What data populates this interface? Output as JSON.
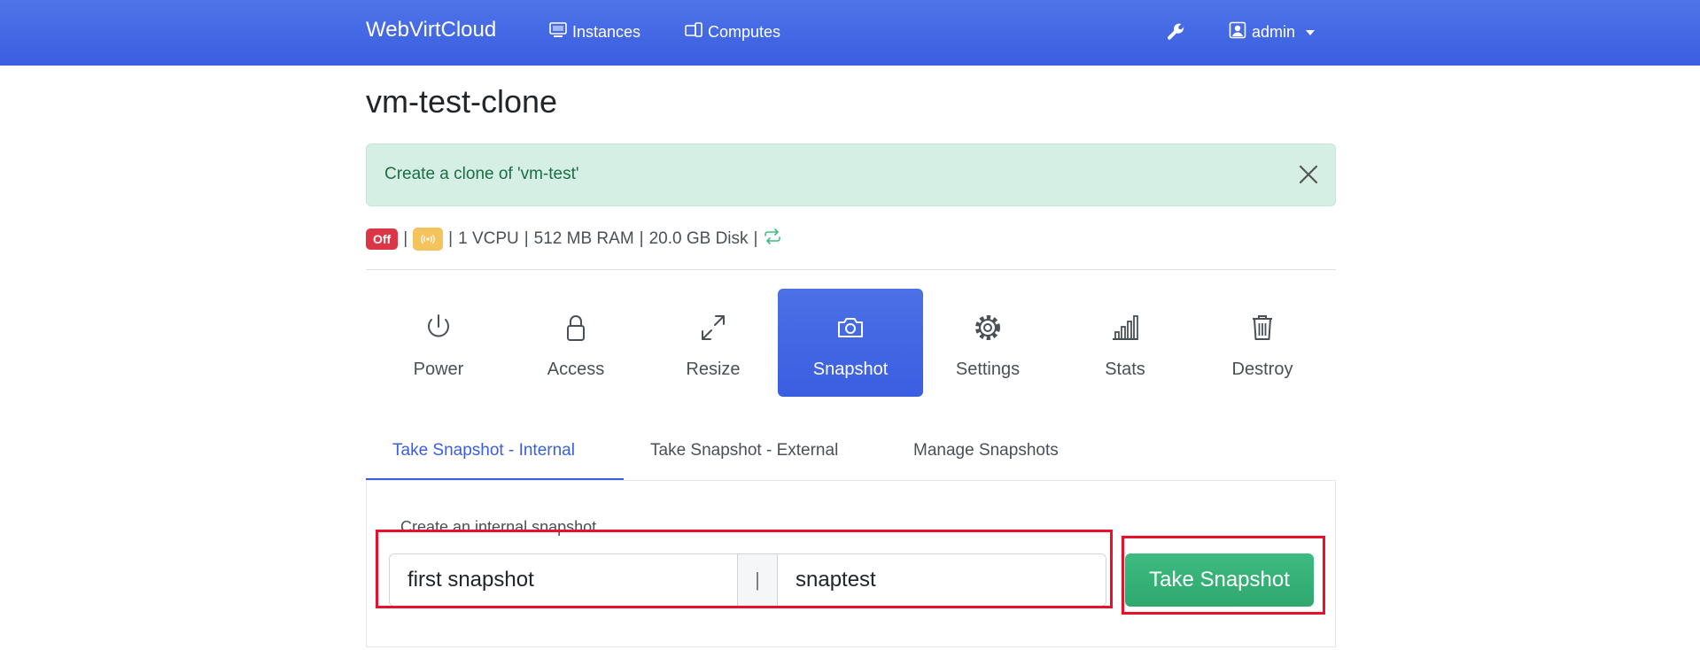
{
  "navbar": {
    "brand": "WebVirtCloud",
    "instances_label": "Instances",
    "computes_label": "Computes",
    "user_label": "admin",
    "icons": {
      "instances": "monitor-icon",
      "computes": "devices-icon",
      "settings": "wrench-icon",
      "user": "user-icon"
    }
  },
  "page": {
    "title": "vm-test-clone"
  },
  "alert": {
    "message": "Create a clone of 'vm-test'"
  },
  "status": {
    "state_badge": "Off",
    "sep": "|",
    "vcpu": "1 VCPU",
    "ram": "512 MB RAM",
    "disk": "20.0 GB Disk",
    "colors": {
      "off": "#dc3545",
      "warn": "#f5c35c",
      "refresh": "#3dbb80"
    }
  },
  "actions": [
    {
      "label": "Power",
      "icon": "power-icon"
    },
    {
      "label": "Access",
      "icon": "lock-icon"
    },
    {
      "label": "Resize",
      "icon": "resize-icon"
    },
    {
      "label": "Snapshot",
      "icon": "camera-icon",
      "active": true
    },
    {
      "label": "Settings",
      "icon": "gear-icon"
    },
    {
      "label": "Stats",
      "icon": "bar-chart-icon"
    },
    {
      "label": "Destroy",
      "icon": "trash-icon"
    }
  ],
  "snapshot_tabs": [
    {
      "label": "Take Snapshot - Internal",
      "active": true
    },
    {
      "label": "Take Snapshot - External"
    },
    {
      "label": "Manage Snapshots"
    }
  ],
  "snapshot_form": {
    "label": "Create an internal snapshot",
    "description_value": "first snapshot",
    "separator": "|",
    "name_value": "snaptest",
    "submit_label": "Take Snapshot"
  },
  "accent": "#3a5ee0"
}
